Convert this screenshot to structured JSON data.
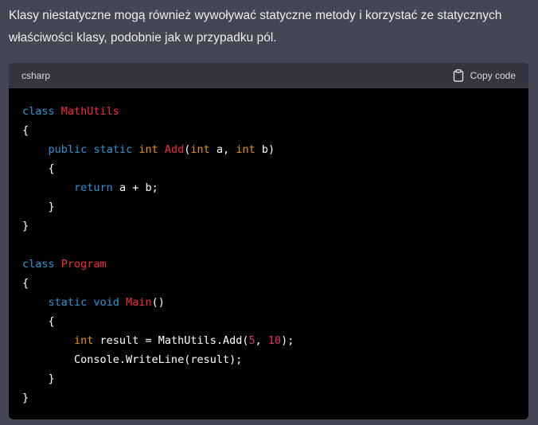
{
  "message": {
    "text": "Klasy niestatyczne mogą również wywoływać statyczne metody i korzystać ze statycznych właściwości klasy, podobnie jak w przypadku pól."
  },
  "code_block": {
    "language": "csharp",
    "copy_label": "Copy code",
    "copy_icon": "clipboard-icon",
    "lines": [
      [
        {
          "t": "class",
          "c": "kw"
        },
        {
          "t": " "
        },
        {
          "t": "MathUtils",
          "c": "nm"
        }
      ],
      [
        {
          "t": "{"
        }
      ],
      [
        {
          "t": "    "
        },
        {
          "t": "public",
          "c": "kw"
        },
        {
          "t": " "
        },
        {
          "t": "static",
          "c": "kw"
        },
        {
          "t": " "
        },
        {
          "t": "int",
          "c": "tp"
        },
        {
          "t": " "
        },
        {
          "t": "Add",
          "c": "nm"
        },
        {
          "t": "("
        },
        {
          "t": "int",
          "c": "tp"
        },
        {
          "t": " a, "
        },
        {
          "t": "int",
          "c": "tp"
        },
        {
          "t": " b)"
        }
      ],
      [
        {
          "t": "    {"
        }
      ],
      [
        {
          "t": "        "
        },
        {
          "t": "return",
          "c": "kw"
        },
        {
          "t": " a + b;"
        }
      ],
      [
        {
          "t": "    }"
        }
      ],
      [
        {
          "t": "}"
        }
      ],
      [],
      [
        {
          "t": "class",
          "c": "kw"
        },
        {
          "t": " "
        },
        {
          "t": "Program",
          "c": "nm"
        }
      ],
      [
        {
          "t": "{"
        }
      ],
      [
        {
          "t": "    "
        },
        {
          "t": "static",
          "c": "kw"
        },
        {
          "t": " "
        },
        {
          "t": "void",
          "c": "kw"
        },
        {
          "t": " "
        },
        {
          "t": "Main",
          "c": "nm"
        },
        {
          "t": "()"
        }
      ],
      [
        {
          "t": "    {"
        }
      ],
      [
        {
          "t": "        "
        },
        {
          "t": "int",
          "c": "tp"
        },
        {
          "t": " result = MathUtils.Add("
        },
        {
          "t": "5",
          "c": "ty"
        },
        {
          "t": ", "
        },
        {
          "t": "10",
          "c": "ty"
        },
        {
          "t": ");"
        }
      ],
      [
        {
          "t": "        Console.WriteLine(result);"
        }
      ],
      [
        {
          "t": "    }"
        }
      ],
      [
        {
          "t": "}"
        }
      ]
    ]
  }
}
